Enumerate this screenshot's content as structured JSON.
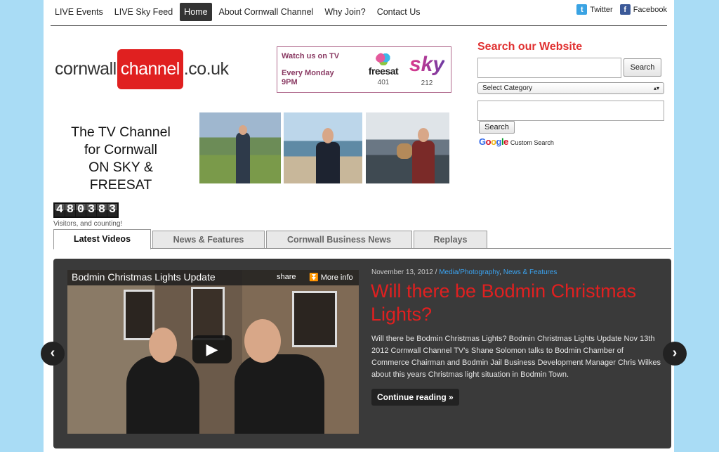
{
  "nav": {
    "items": [
      {
        "label": "LIVE Events",
        "active": false
      },
      {
        "label": "LIVE Sky Feed",
        "active": false
      },
      {
        "label": "Home",
        "active": true
      },
      {
        "label": "About Cornwall Channel",
        "active": false
      },
      {
        "label": "Why Join?",
        "active": false
      },
      {
        "label": "Contact Us",
        "active": false
      }
    ],
    "social": {
      "twitter": "Twitter",
      "facebook": "Facebook"
    }
  },
  "logo": {
    "pre": "cornwall",
    "mid": "channel",
    "post": ".co.uk"
  },
  "watch": {
    "title": "Watch us on TV",
    "schedule": "Every Monday 9PM",
    "freesat_label": "freesat",
    "freesat_channel": "401",
    "sky_label": "sky",
    "sky_channel": "212"
  },
  "search": {
    "title": "Search our Website",
    "button": "Search",
    "category_selected": "Select Category",
    "google_button": "Search",
    "google_caption": "Custom Search"
  },
  "tagline": {
    "line1": "The TV Channel",
    "line2": "for Cornwall",
    "line3": "ON SKY & FREESAT"
  },
  "counter": {
    "value": "480383",
    "caption": "Visitors, and counting!"
  },
  "tabs": [
    {
      "label": "Latest Videos",
      "active": true
    },
    {
      "label": "News & Features",
      "active": false
    },
    {
      "label": "Cornwall Business News",
      "active": false
    },
    {
      "label": "Replays",
      "active": false
    }
  ],
  "feature": {
    "video_title": "Bodmin Christmas Lights Update",
    "share": "share",
    "more_info": "More info",
    "date": "November 13, 2012",
    "sep": " / ",
    "category1": "Media/Photography",
    "category2": "News & Features",
    "headline": "Will there be Bodmin Christmas Lights?",
    "excerpt": "Will there be Bodmin Christmas Lights? Bodmin Christmas Lights Update Nov 13th 2012 Cornwall Channel TV's Shane Solomon talks to Bodmin Chamber of Commerce Chairman and Bodmin Jail Business Development Manager Chris Wilkes about this years Christmas light situation in Bodmin Town.",
    "continue": "Continue reading »"
  },
  "icons": {
    "prev": "chevron-left-icon",
    "next": "chevron-right-icon",
    "play": "play-icon"
  },
  "colors": {
    "accent": "#e02020",
    "background": "#a9dcf5",
    "link": "#3aa3f0"
  }
}
